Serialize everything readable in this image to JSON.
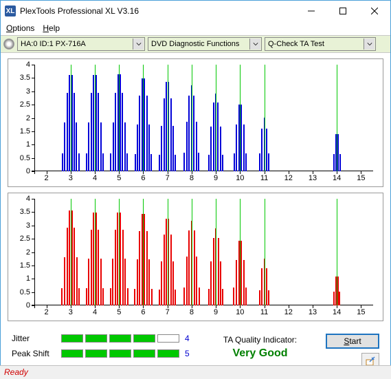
{
  "window": {
    "title": "PlexTools Professional XL V3.16",
    "app_icon": "XL"
  },
  "menu": {
    "options": "Options",
    "help": "Help"
  },
  "toolbar": {
    "device": "HA:0 ID:1  PX-716A",
    "func_group": "DVD Diagnostic Functions",
    "test": "Q-Check TA Test"
  },
  "chart_data": [
    {
      "type": "bar",
      "color": "#0000d8",
      "ylim": [
        0,
        4
      ],
      "xlim": [
        1.5,
        15.5
      ],
      "yticks": [
        0,
        0.5,
        1,
        1.5,
        2,
        2.5,
        3,
        3.5,
        4
      ],
      "xticks": [
        2,
        3,
        4,
        5,
        6,
        7,
        8,
        9,
        10,
        11,
        12,
        13,
        14,
        15
      ],
      "markers": [
        3,
        4,
        5,
        6,
        7,
        8,
        9,
        10,
        11,
        14
      ],
      "peaks": [
        {
          "c": 3,
          "h": 3.7,
          "w": 0.88
        },
        {
          "c": 4,
          "h": 3.7,
          "w": 0.88
        },
        {
          "c": 5,
          "h": 3.72,
          "w": 0.88
        },
        {
          "c": 6,
          "h": 3.58,
          "w": 0.86
        },
        {
          "c": 7,
          "h": 3.44,
          "w": 0.84
        },
        {
          "c": 8,
          "h": 3.22,
          "w": 0.8
        },
        {
          "c": 9,
          "h": 2.92,
          "w": 0.76
        },
        {
          "c": 10,
          "h": 2.6,
          "w": 0.7
        },
        {
          "c": 11,
          "h": 2.02,
          "w": 0.58
        },
        {
          "c": 14,
          "h": 1.52,
          "w": 0.42
        }
      ]
    },
    {
      "type": "bar",
      "color": "#e80000",
      "ylim": [
        0,
        4
      ],
      "xlim": [
        1.5,
        15.5
      ],
      "yticks": [
        0,
        0.5,
        1,
        1.5,
        2,
        2.5,
        3,
        3.5,
        4
      ],
      "xticks": [
        2,
        3,
        4,
        5,
        6,
        7,
        8,
        9,
        10,
        11,
        12,
        13,
        14,
        15
      ],
      "markers": [
        3,
        4,
        5,
        6,
        7,
        8,
        9,
        10,
        11,
        14
      ],
      "peaks": [
        {
          "c": 3,
          "h": 3.66,
          "w": 0.9
        },
        {
          "c": 4,
          "h": 3.56,
          "w": 0.9
        },
        {
          "c": 5,
          "h": 3.56,
          "w": 0.9
        },
        {
          "c": 6,
          "h": 3.52,
          "w": 0.88
        },
        {
          "c": 7,
          "h": 3.34,
          "w": 0.86
        },
        {
          "c": 8,
          "h": 3.18,
          "w": 0.82
        },
        {
          "c": 9,
          "h": 2.88,
          "w": 0.78
        },
        {
          "c": 10,
          "h": 2.52,
          "w": 0.72
        },
        {
          "c": 11,
          "h": 1.76,
          "w": 0.58
        },
        {
          "c": 14,
          "h": 1.18,
          "w": 0.38
        }
      ]
    }
  ],
  "metrics": {
    "jitter": {
      "label": "Jitter",
      "value": "4",
      "filled": 4,
      "total": 5
    },
    "peakshift": {
      "label": "Peak Shift",
      "value": "5",
      "filled": 5,
      "total": 5
    }
  },
  "quality": {
    "label": "TA Quality Indicator:",
    "value": "Very Good"
  },
  "buttons": {
    "start": "Start"
  },
  "status": "Ready"
}
